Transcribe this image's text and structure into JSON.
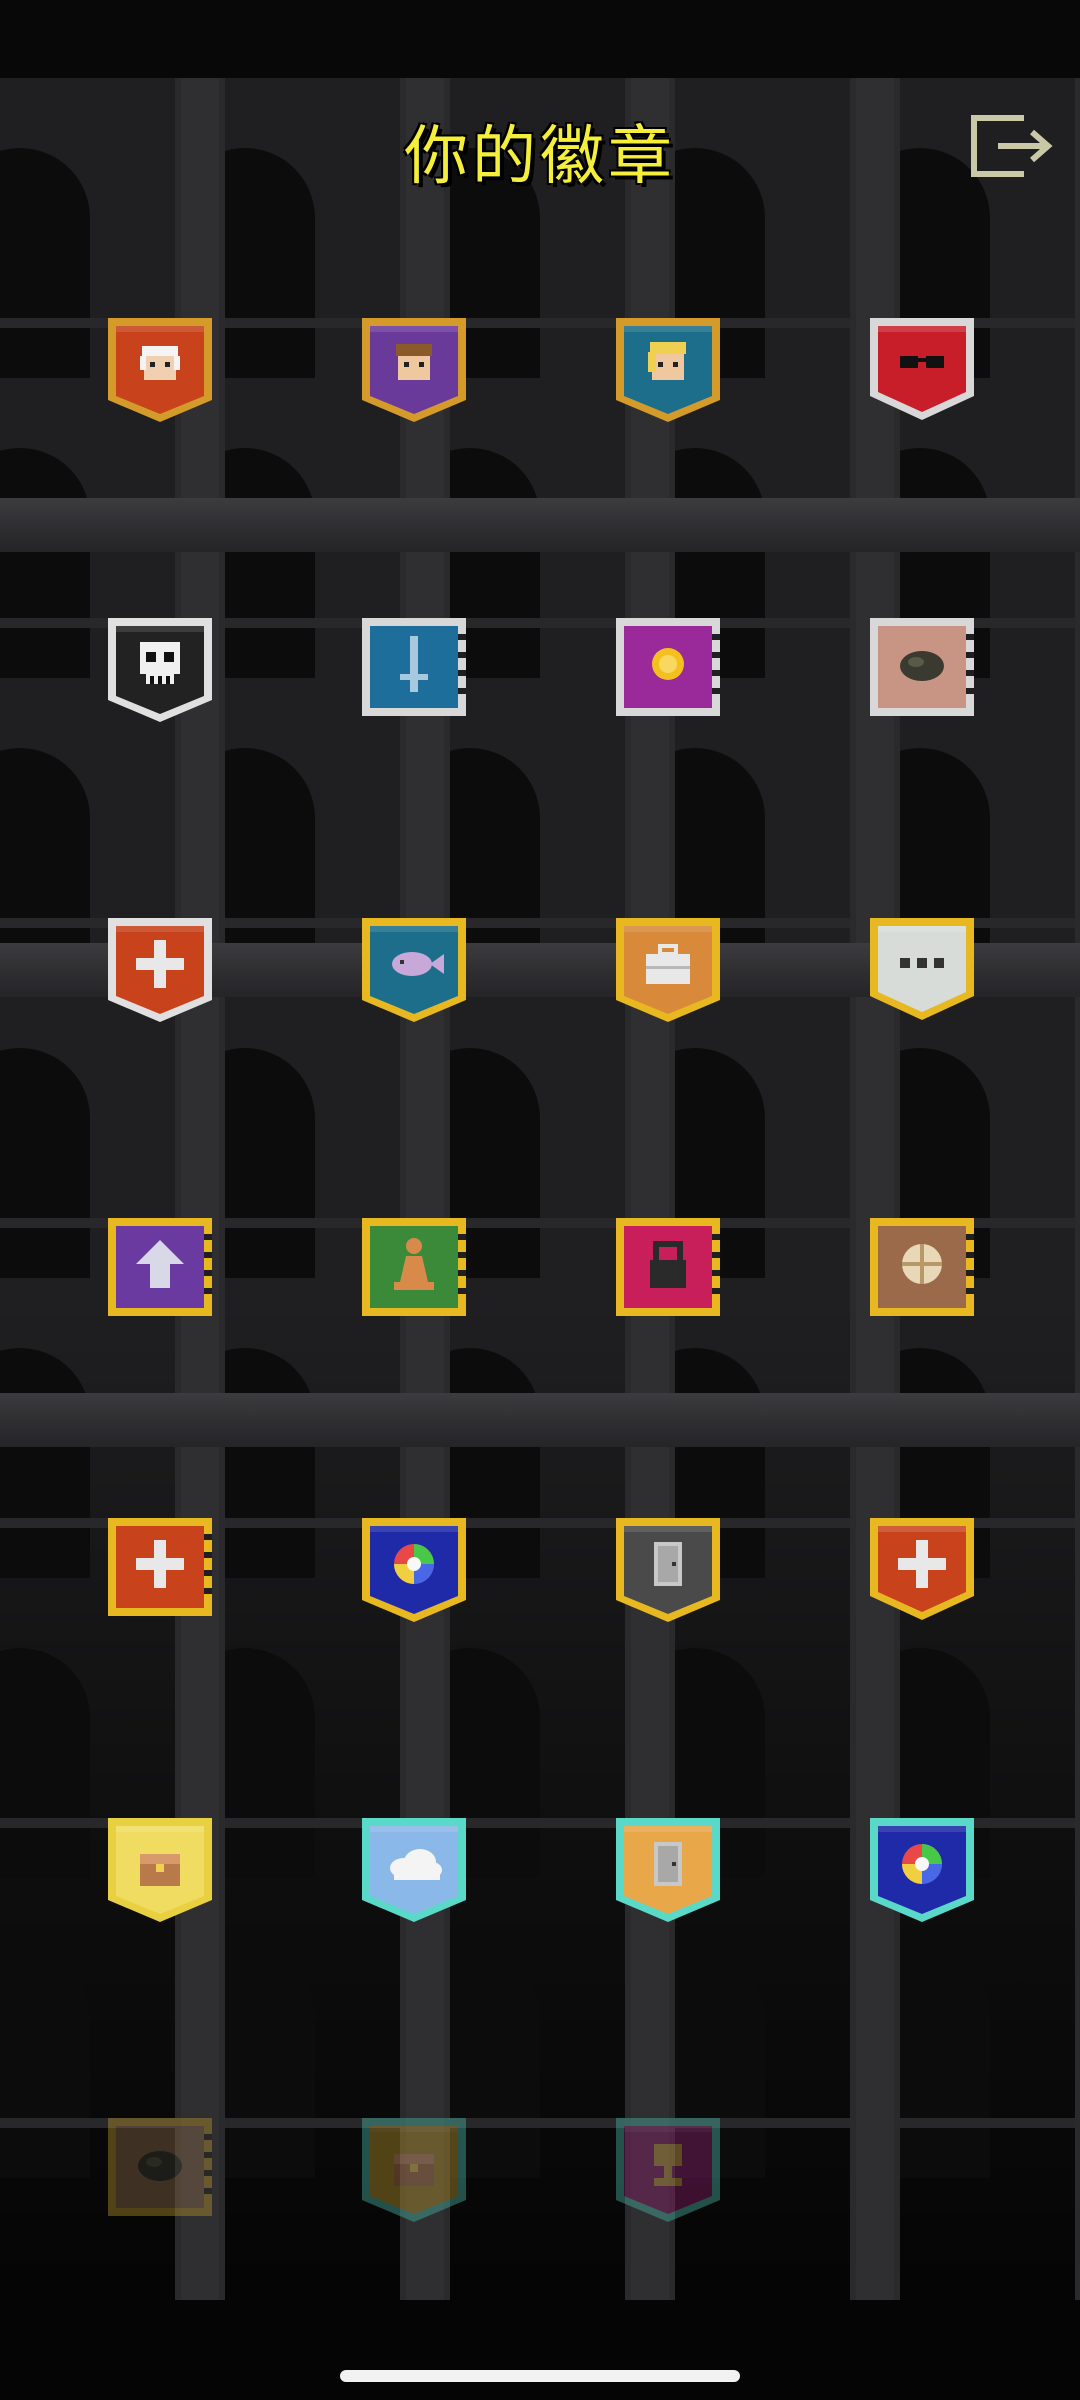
{
  "header": {
    "title": "你的徽章",
    "exit_icon": "exit-icon"
  },
  "badges": [
    {
      "row": 1,
      "col": 1,
      "icon": "bald-man-face-icon",
      "frame": "#d49a2a",
      "bg": "#c8421c",
      "unlocked": true,
      "shape": "shield"
    },
    {
      "row": 1,
      "col": 2,
      "icon": "brown-hair-face-icon",
      "frame": "#d49a2a",
      "bg": "#6a3a9a",
      "unlocked": true,
      "shape": "shield"
    },
    {
      "row": 1,
      "col": 3,
      "icon": "blonde-face-icon",
      "frame": "#d49a2a",
      "bg": "#1d6e8a",
      "unlocked": true,
      "shape": "shield"
    },
    {
      "row": 1,
      "col": 4,
      "icon": "sunglasses-icon",
      "frame": "#d8d8d8",
      "bg": "#c81e2a",
      "unlocked": true,
      "shape": "banner"
    },
    {
      "row": 2,
      "col": 1,
      "icon": "skull-icon",
      "frame": "#e0e0e0",
      "bg": "#222222",
      "unlocked": true,
      "shape": "shield"
    },
    {
      "row": 2,
      "col": 2,
      "icon": "sword-icon",
      "frame": "#d8d8d8",
      "bg": "#1d6e9a",
      "unlocked": true,
      "shape": "scroll"
    },
    {
      "row": 2,
      "col": 3,
      "icon": "gold-coin-icon",
      "frame": "#d8d8d8",
      "bg": "#9a2a9a",
      "unlocked": true,
      "shape": "scroll"
    },
    {
      "row": 2,
      "col": 4,
      "icon": "coal-rock-icon",
      "frame": "#d8d8d8",
      "bg": "#c89484",
      "unlocked": true,
      "shape": "scroll"
    },
    {
      "row": 3,
      "col": 1,
      "icon": "medic-cross-icon",
      "frame": "#e0e0e0",
      "bg": "#c8421c",
      "unlocked": true,
      "shape": "shield"
    },
    {
      "row": 3,
      "col": 2,
      "icon": "fish-icon",
      "frame": "#e8b820",
      "bg": "#1d6e8a",
      "unlocked": true,
      "shape": "shield"
    },
    {
      "row": 3,
      "col": 3,
      "icon": "briefcase-icon",
      "frame": "#e8b820",
      "bg": "#d88a3a",
      "unlocked": true,
      "shape": "shield"
    },
    {
      "row": 3,
      "col": 4,
      "icon": "ellipsis-icon",
      "frame": "#e8b820",
      "bg": "#d8dcd8",
      "unlocked": true,
      "shape": "banner"
    },
    {
      "row": 4,
      "col": 1,
      "icon": "up-arrow-icon",
      "frame": "#e8b820",
      "bg": "#6a3aa0",
      "unlocked": true,
      "shape": "scroll"
    },
    {
      "row": 4,
      "col": 2,
      "icon": "chess-pawn-icon",
      "frame": "#e8b820",
      "bg": "#3a8a3a",
      "unlocked": true,
      "shape": "scroll"
    },
    {
      "row": 4,
      "col": 3,
      "icon": "padlock-icon",
      "frame": "#e8b820",
      "bg": "#c81e5a",
      "unlocked": true,
      "shape": "scroll"
    },
    {
      "row": 4,
      "col": 4,
      "icon": "seed-icon",
      "frame": "#e8b820",
      "bg": "#9a6a4a",
      "unlocked": true,
      "shape": "scroll"
    },
    {
      "row": 5,
      "col": 1,
      "icon": "medic-cross-icon",
      "frame": "#e8b820",
      "bg": "#c8421c",
      "unlocked": true,
      "shape": "scroll"
    },
    {
      "row": 5,
      "col": 2,
      "icon": "rainbow-orb-icon",
      "frame": "#e8b820",
      "bg": "#1e2aa8",
      "unlocked": true,
      "shape": "shield"
    },
    {
      "row": 5,
      "col": 3,
      "icon": "door-icon",
      "frame": "#e8b820",
      "bg": "#4a4a4a",
      "unlocked": true,
      "shape": "shield"
    },
    {
      "row": 5,
      "col": 4,
      "icon": "medic-cross-icon",
      "frame": "#e8b820",
      "bg": "#c8421c",
      "unlocked": true,
      "shape": "banner"
    },
    {
      "row": 6,
      "col": 1,
      "icon": "treasure-chest-icon",
      "frame": "#e8d040",
      "bg": "#f0dc60",
      "unlocked": true,
      "shape": "shield"
    },
    {
      "row": 6,
      "col": 2,
      "icon": "cloud-icon",
      "frame": "#5ad8c8",
      "bg": "#8ab8e8",
      "unlocked": true,
      "shape": "shield"
    },
    {
      "row": 6,
      "col": 3,
      "icon": "door-icon",
      "frame": "#5ad8c8",
      "bg": "#e8a84a",
      "unlocked": true,
      "shape": "shield"
    },
    {
      "row": 6,
      "col": 4,
      "icon": "rainbow-orb-icon",
      "frame": "#5ad8c8",
      "bg": "#1e2aa8",
      "unlocked": true,
      "shape": "shield"
    },
    {
      "row": 7,
      "col": 1,
      "icon": "coal-rock-icon",
      "frame": "#b8962a",
      "bg": "#8a6a4a",
      "unlocked": false,
      "shape": "scroll"
    },
    {
      "row": 7,
      "col": 2,
      "icon": "treasure-chest-icon",
      "frame": "#4ab8a8",
      "bg": "#b8962a",
      "unlocked": false,
      "shape": "shield"
    },
    {
      "row": 7,
      "col": 3,
      "icon": "trophy-icon",
      "frame": "#4ab8a8",
      "bg": "#8a1e6a",
      "unlocked": false,
      "shape": "shield"
    }
  ]
}
